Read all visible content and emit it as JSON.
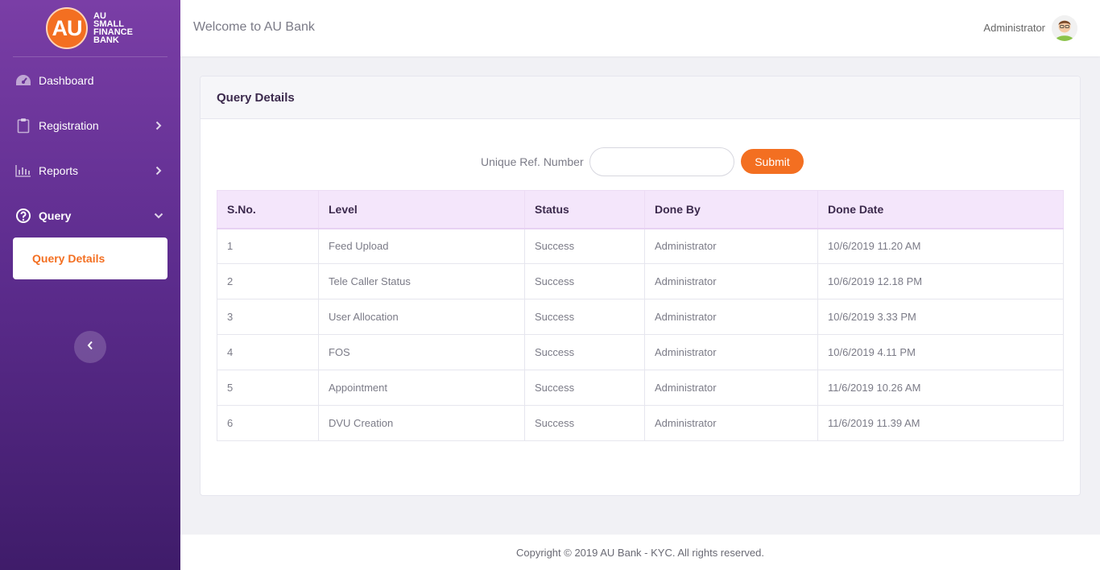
{
  "brand": {
    "logo_letters": "AU",
    "logo_line1": "AU",
    "logo_line2": "SMALL",
    "logo_line3": "FINANCE",
    "logo_line4": "BANK"
  },
  "sidebar": {
    "items": [
      {
        "label": "Dashboard",
        "icon": "speedometer-icon"
      },
      {
        "label": "Registration",
        "icon": "clipboard-icon"
      },
      {
        "label": "Reports",
        "icon": "bar-chart-icon"
      },
      {
        "label": "Query",
        "icon": "question-circle-icon"
      }
    ],
    "sub_item": "Query Details"
  },
  "header": {
    "welcome": "Welcome to AU Bank",
    "user": "Administrator"
  },
  "card": {
    "title": "Query Details",
    "search_label": "Unique Ref. Number",
    "search_value": "",
    "submit_label": "Submit"
  },
  "table": {
    "columns": [
      "S.No.",
      "Level",
      "Status",
      "Done By",
      "Done Date"
    ],
    "rows": [
      [
        "1",
        "Feed Upload",
        "Success",
        "Administrator",
        "10/6/2019 11.20 AM"
      ],
      [
        "2",
        "Tele Caller Status",
        "Success",
        "Administrator",
        "10/6/2019 12.18 PM"
      ],
      [
        "3",
        "User Allocation",
        "Success",
        "Administrator",
        "10/6/2019 3.33 PM"
      ],
      [
        "4",
        "FOS",
        "Success",
        "Administrator",
        "10/6/2019 4.11 PM"
      ],
      [
        "5",
        "Appointment",
        "Success",
        "Administrator",
        "11/6/2019 10.26 AM"
      ],
      [
        "6",
        "DVU Creation",
        "Success",
        "Administrator",
        "11/6/2019 11.39 AM"
      ]
    ]
  },
  "footer": {
    "text": "Copyright © 2019 AU Bank - KYC. All rights reserved."
  },
  "colors": {
    "accent": "#f36f21",
    "sidebar_top": "#7a3ea6",
    "sidebar_bottom": "#3f1c6a",
    "table_header_bg": "#f4e6fb"
  }
}
